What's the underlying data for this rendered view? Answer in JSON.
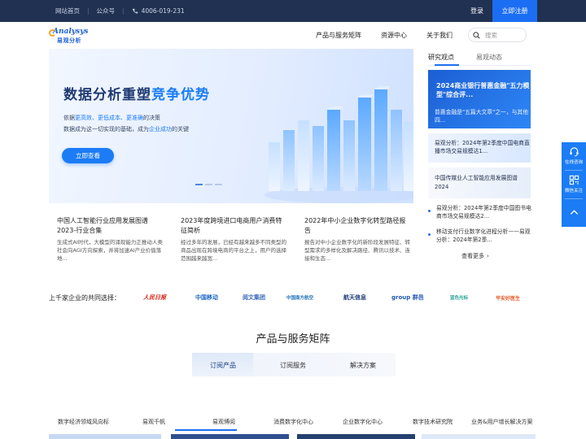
{
  "topbar": {
    "home": "网站首页",
    "wechat": "公众号",
    "phone": "4006-019-231",
    "login": "登录",
    "register": "立即注册"
  },
  "header": {
    "logo_en": "Analysys",
    "logo_zh": "易观分析",
    "nav": [
      "产品与服务矩阵",
      "资源中心",
      "关于我们"
    ],
    "search_placeholder": "搜索"
  },
  "hero": {
    "title_main": "数据分析重塑",
    "title_accent": "竞争优势",
    "line1_a": "依据",
    "line1_b": "更高效、更低成本、更准确",
    "line1_c": "的决策",
    "line2_a": "数据成为这一切实现的基础，成为",
    "line2_b": "企业成功",
    "line2_c": "的关键",
    "button": "立即查看"
  },
  "articles": [
    {
      "title": "中国人工智能行业应用发展图谱2023-行业合集",
      "desc": "生成式AI时代，大模型的涌现能力正推动人类社会向AGI方向探索，并将加速AI产业价值落地..."
    },
    {
      "title": "2023年度跨境进口电商用户消费特征简析",
      "desc": "经过多年的发展，已经有越来越多不同类型的商品出现在跨境电商的平台之上，用户的选择范围越来越宽..."
    },
    {
      "title": "2022年中小企业数字化转型路径报告",
      "desc": "报告对中小企业数字化的新阶段发展特征、转型需求的多样化及解决路径、腾讯以技术、连接和生态..."
    }
  ],
  "right": {
    "tabs": [
      "研究观点",
      "易观动态"
    ],
    "card1_big": "2024商业银行普惠金融\"五力模型\"综合评...",
    "card1_sub": "普惠金融是\"五篇大文章\"之一，与其他四...",
    "card2": "易观分析：2024年第2季度中国电商直播市场交易规模达1...",
    "card3": "中国传媒业人工智能应用发展图谱2024",
    "list": [
      "易观分析：2024年第2季度中国图书电商市场交易规模达2...",
      "移动支付行业数字化进程分析——易观分析：2024年第2季..."
    ],
    "more": "查看更多"
  },
  "partners": {
    "label": "上千家企业的共同选择：",
    "logos": [
      {
        "name": "人民日报",
        "color": "#d8261c"
      },
      {
        "name": "中国移动",
        "color": "#1d66c3"
      },
      {
        "name": "阅文集团",
        "color": "#3768b8"
      },
      {
        "name": "中国南方航空",
        "color": "#1f71b8"
      },
      {
        "name": "航天信息",
        "color": "#1d3a7a"
      },
      {
        "name": "group 群邑",
        "color": "#2459b3"
      },
      {
        "name": "蓝色光标",
        "color": "#2aa199"
      },
      {
        "name": "平安好医生",
        "color": "#e35b2a"
      }
    ]
  },
  "products": {
    "title": "产品与服务矩阵",
    "tabs": [
      "订阅产品",
      "订阅服务",
      "解决方案"
    ],
    "categories": [
      "数字经济领域风向标",
      "易观千帆",
      "易观博阅",
      "消费数字化中心",
      "企业数字化中心",
      "数字技术研究院",
      "业务&用户增长解决方案"
    ]
  },
  "float": {
    "items": [
      "在线咨询",
      "微信关注"
    ]
  },
  "colors": {
    "primary": "#1b6ef3",
    "topbar": "#213152"
  }
}
